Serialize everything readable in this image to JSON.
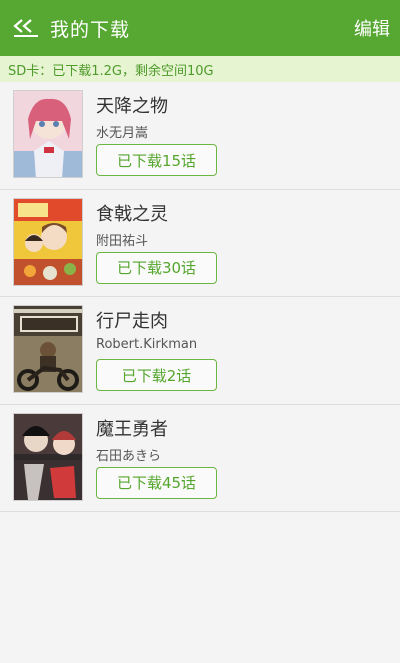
{
  "header": {
    "title": "我的下载",
    "edit_label": "编辑"
  },
  "storage": {
    "text": "SD卡：已下载1.2G，剩余空间10G"
  },
  "items": [
    {
      "name": "天降之物",
      "author": "水无月嵩",
      "download_label": "已下载15话"
    },
    {
      "name": "食戟之灵",
      "author": "附田祐斗",
      "download_label": "已下载30话"
    },
    {
      "name": "行尸走肉",
      "author": "Robert.Kirkman",
      "download_label": "已下载2话"
    },
    {
      "name": "魔王勇者",
      "author": "石田あきら",
      "download_label": "已下载45话"
    }
  ],
  "colors": {
    "header_bg": "#56a832",
    "accent": "#55a62e",
    "storage_bg": "#e6f4d2"
  }
}
